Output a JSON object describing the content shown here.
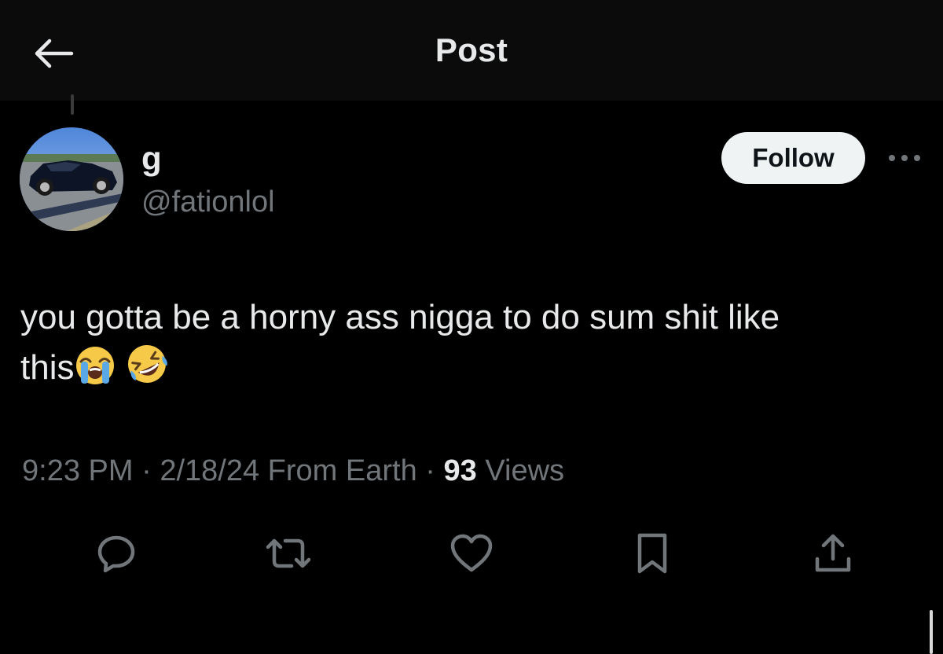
{
  "header": {
    "title": "Post",
    "back_icon": "arrow-left-icon"
  },
  "author": {
    "display_name": "g",
    "handle": "@fationlol",
    "avatar_icon": "avatar-car-photo"
  },
  "follow_label": "Follow",
  "more_icon": "more-horizontal-icon",
  "post": {
    "text_line1": "you gotta be a horny ass nigga to do sum shit like",
    "text_line2": "this",
    "emojis": [
      "loudly-crying-face",
      "rolling-on-floor-laughing"
    ]
  },
  "meta": {
    "time": "9:23 PM",
    "date": "2/18/24",
    "from": "From Earth",
    "views_count": "93",
    "views_label": "Views",
    "separator": "·"
  },
  "actions": [
    {
      "name": "reply-icon"
    },
    {
      "name": "repost-icon"
    },
    {
      "name": "like-icon"
    },
    {
      "name": "bookmark-icon"
    },
    {
      "name": "share-icon"
    }
  ],
  "colors": {
    "background": "#000000",
    "header_bg": "#0b0b0b",
    "text_primary": "#e7e9ea",
    "text_secondary": "#71767b",
    "follow_bg": "#eff3f4"
  }
}
